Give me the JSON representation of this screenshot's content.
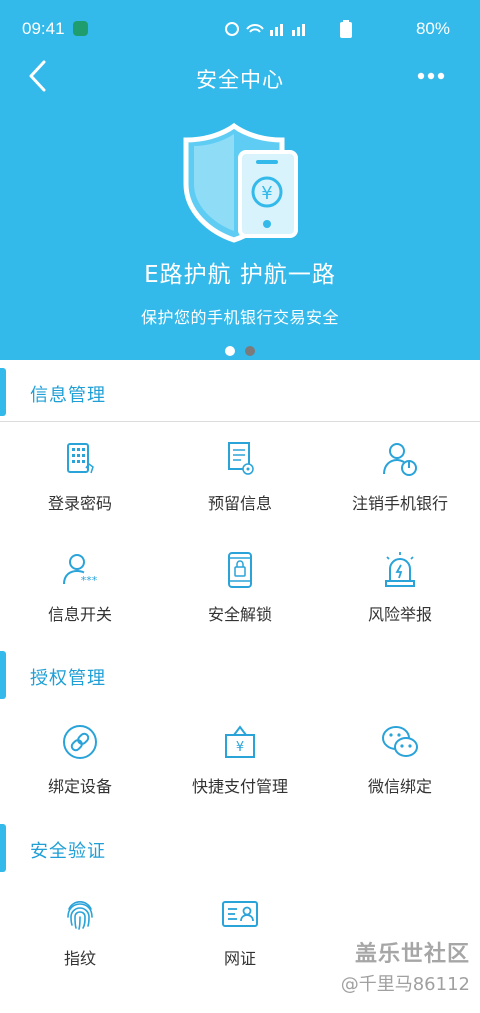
{
  "status": {
    "time": "09:41",
    "battery": "80%"
  },
  "nav": {
    "title": "安全中心"
  },
  "banner": {
    "title": "E路护航 护航一路",
    "subtitle": "保护您的手机银行交易安全",
    "slide_current": 1,
    "slide_count": 2
  },
  "sections": [
    {
      "title": "信息管理",
      "items": [
        {
          "label": "登录密码",
          "icon": "keypad-icon"
        },
        {
          "label": "预留信息",
          "icon": "document-icon"
        },
        {
          "label": "注销手机银行",
          "icon": "user-power-icon"
        },
        {
          "label": "信息开关",
          "icon": "user-password-icon"
        },
        {
          "label": "安全解锁",
          "icon": "phone-lock-icon"
        },
        {
          "label": "风险举报",
          "icon": "alarm-icon"
        }
      ]
    },
    {
      "title": "授权管理",
      "items": [
        {
          "label": "绑定设备",
          "icon": "link-icon"
        },
        {
          "label": "快捷支付管理",
          "icon": "payment-bag-icon"
        },
        {
          "label": "微信绑定",
          "icon": "wechat-icon"
        }
      ]
    },
    {
      "title": "安全验证",
      "items": [
        {
          "label": "指纹",
          "icon": "fingerprint-icon"
        },
        {
          "label": "网证",
          "icon": "id-card-icon"
        }
      ]
    }
  ],
  "watermark": {
    "main": "盖乐世社区",
    "sub": "@千里马86112"
  },
  "colors": {
    "primary": "#33b9ea",
    "section_title": "#1f9fd6",
    "icon": "#2aa3d9"
  }
}
